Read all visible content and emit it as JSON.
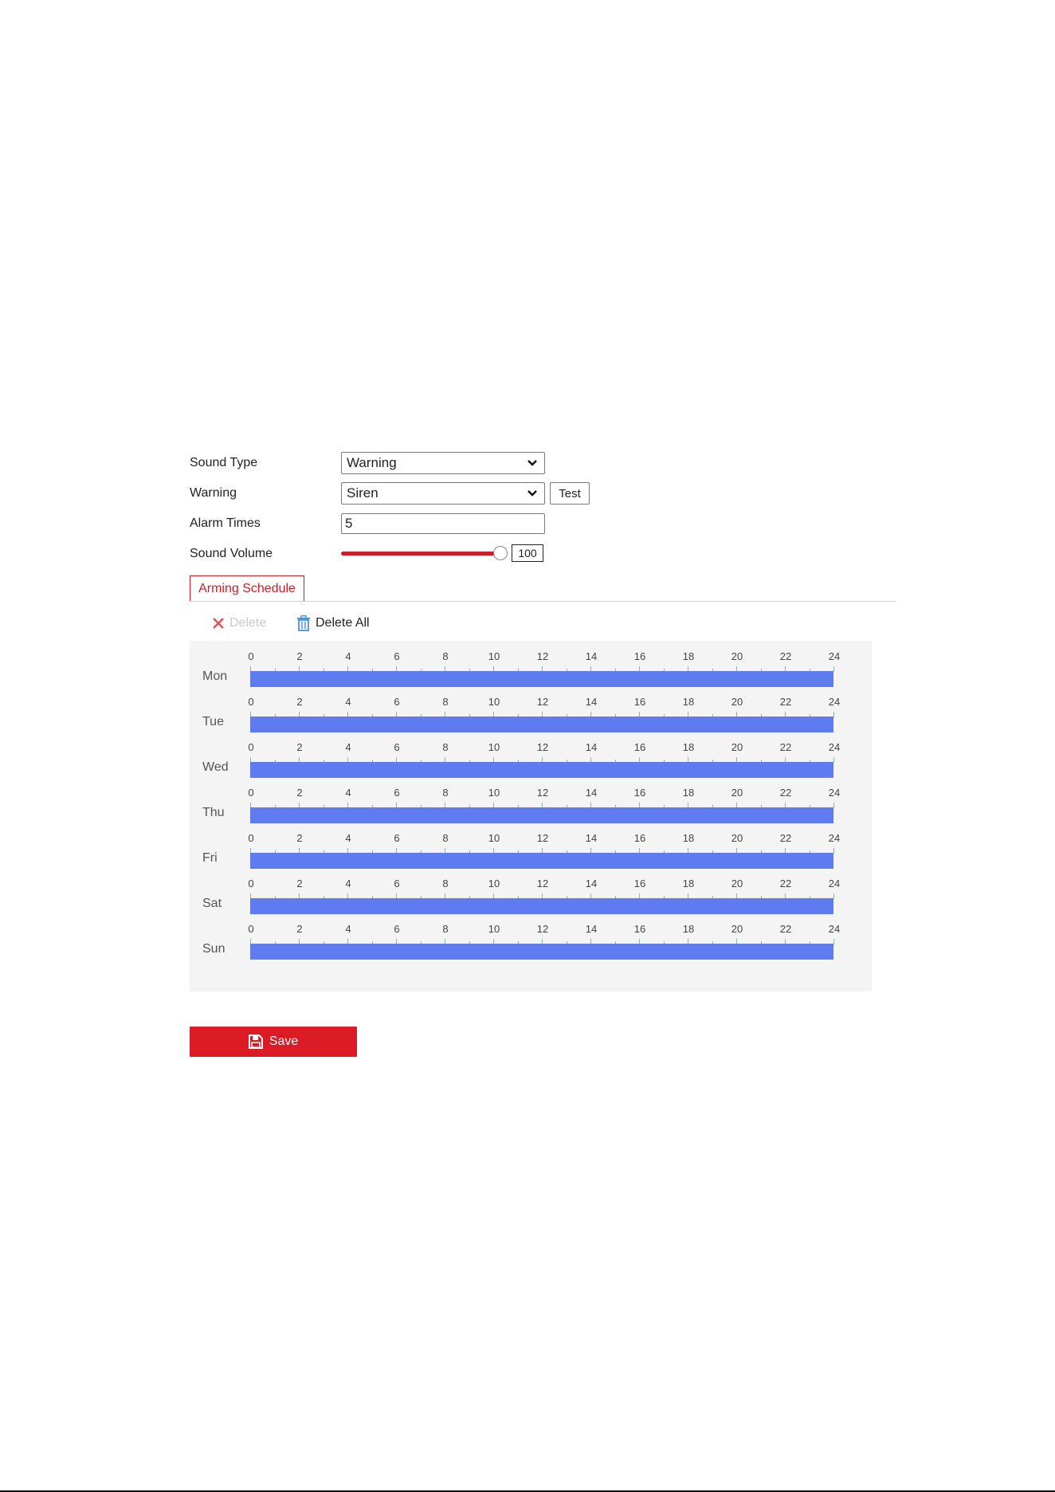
{
  "form": {
    "sound_type": {
      "label": "Sound Type",
      "value": "Warning"
    },
    "warning": {
      "label": "Warning",
      "value": "Siren",
      "test_label": "Test"
    },
    "alarm_times": {
      "label": "Alarm Times",
      "value": "5"
    },
    "sound_volume": {
      "label": "Sound Volume",
      "value": "100",
      "level": 1.0
    }
  },
  "tabs": {
    "active": "Arming Schedule"
  },
  "toolbar": {
    "delete_label": "Delete",
    "delete_all_label": "Delete All"
  },
  "schedule": {
    "hour_labels": [
      "0",
      "2",
      "4",
      "6",
      "8",
      "10",
      "12",
      "14",
      "16",
      "18",
      "20",
      "22",
      "24"
    ],
    "days": [
      {
        "label": "Mon",
        "start": 0,
        "end": 24
      },
      {
        "label": "Tue",
        "start": 0,
        "end": 24
      },
      {
        "label": "Wed",
        "start": 0,
        "end": 24
      },
      {
        "label": "Thu",
        "start": 0,
        "end": 24
      },
      {
        "label": "Fri",
        "start": 0,
        "end": 24
      },
      {
        "label": "Sat",
        "start": 0,
        "end": 24
      },
      {
        "label": "Sun",
        "start": 0,
        "end": 24
      }
    ],
    "bar_color": "#5e7bef"
  },
  "save_button": {
    "label": "Save"
  },
  "colors": {
    "accent": "#db1c24",
    "tab_accent": "#c8202a",
    "delete_icon": "#e25555",
    "trash_icon": "#4a90d9"
  }
}
